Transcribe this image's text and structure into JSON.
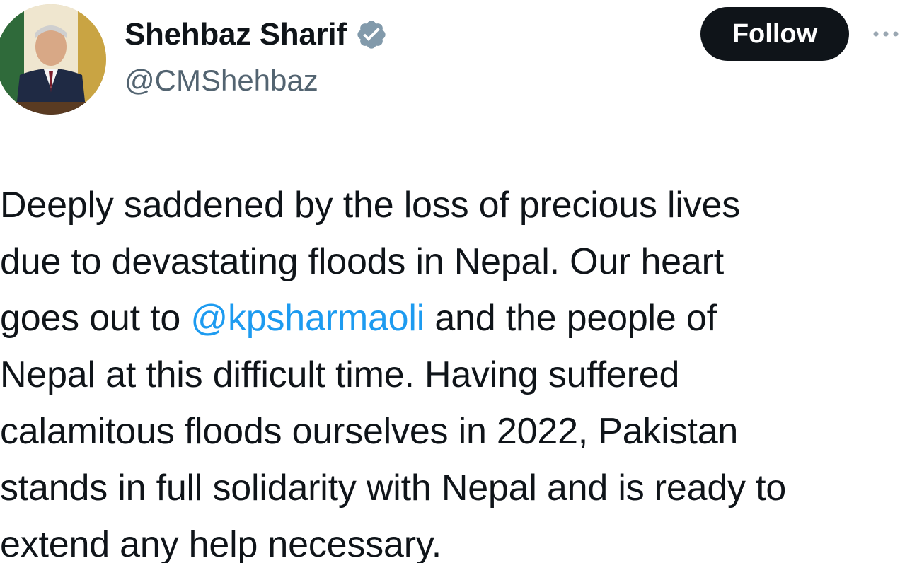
{
  "author": {
    "display_name": "Shehbaz Sharif",
    "handle": "@CMShehbaz",
    "verified_icon": "verified-badge-icon",
    "avatar": "profile-photo"
  },
  "actions": {
    "follow_label": "Follow",
    "more_icon": "more-options-icon"
  },
  "tweet": {
    "lines": [
      {
        "before": "Deeply saddened by the loss of precious lives",
        "mention": "",
        "after": ""
      },
      {
        "before": "due to devastating floods in Nepal. Our heart",
        "mention": "",
        "after": ""
      },
      {
        "before": "goes out to ",
        "mention": "@kpsharmaoli",
        "after": " and the people of"
      },
      {
        "before": "Nepal at this difficult time. Having suffered",
        "mention": "",
        "after": ""
      },
      {
        "before": "calamitous floods ourselves in 2022, Pakistan",
        "mention": "",
        "after": ""
      },
      {
        "before": "stands in full solidarity with Nepal and is ready to",
        "mention": "",
        "after": ""
      },
      {
        "before": "extend any help necessary.",
        "mention": "",
        "after": ""
      }
    ]
  },
  "colors": {
    "text": "#0f1419",
    "secondary": "#536471",
    "link": "#1d9bf0",
    "verified": "#829aab",
    "button_bg": "#0f1419",
    "button_text": "#ffffff"
  }
}
